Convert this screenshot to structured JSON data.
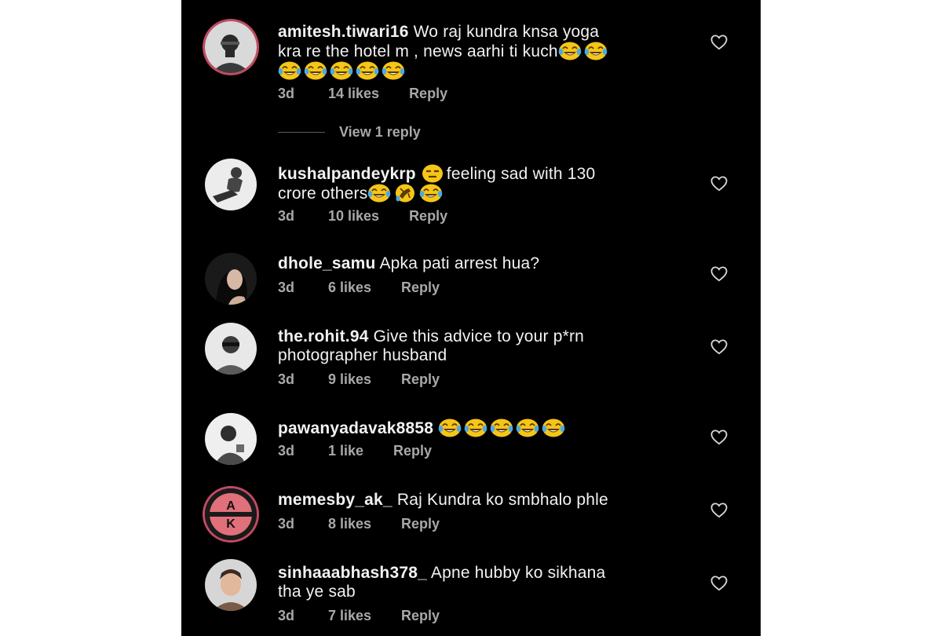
{
  "comments": [
    {
      "username": "amitesh.tiwari16",
      "text_lines": [
        "Wo raj kundra knsa yoga",
        "kra re the hotel m , news aarhi ti kuch",
        ""
      ],
      "time": "3d",
      "likes": "14 likes",
      "reply": "Reply"
    },
    {
      "username": "kushalpandeykrp",
      "text_lines": [
        "feeling sad with 130",
        "crore others"
      ],
      "time": "3d",
      "likes": "10 likes",
      "reply": "Reply"
    },
    {
      "username": "dhole_samu",
      "text_lines": [
        "Apka pati arrest hua?"
      ],
      "time": "3d",
      "likes": "6 likes",
      "reply": "Reply"
    },
    {
      "username": "the.rohit.94",
      "text_lines": [
        "Give this advice to your p*rn",
        "photographer husband"
      ],
      "time": "3d",
      "likes": "9 likes",
      "reply": "Reply"
    },
    {
      "username": "pawanyadavak8858",
      "text_lines": [
        ""
      ],
      "time": "3d",
      "likes": "1 like",
      "reply": "Reply"
    },
    {
      "username": "memesby_ak_",
      "text_lines": [
        "Raj Kundra ko smbhalo phle"
      ],
      "time": "3d",
      "likes": "8 likes",
      "reply": "Reply"
    },
    {
      "username": "sinhaaabhash378_",
      "text_lines": [
        "Apne hubby ko sikhana",
        "tha ye sab"
      ],
      "time": "3d",
      "likes": "7 likes",
      "reply": "Reply"
    }
  ],
  "view_replies": "View 1 reply",
  "avatar_logo_text": "AK",
  "icons": {
    "like": "heart-outline-icon",
    "laugh": "face-with-tears-of-joy-emoji",
    "rofl": "rolling-on-floor-laughing-emoji",
    "expressionless": "expressionless-face-emoji"
  },
  "colors": {
    "background": "#000000",
    "text": "#f2f2f2",
    "secondary": "#a8a8a8",
    "emoji": "#f5c518",
    "story_ring": "#c24a62"
  }
}
